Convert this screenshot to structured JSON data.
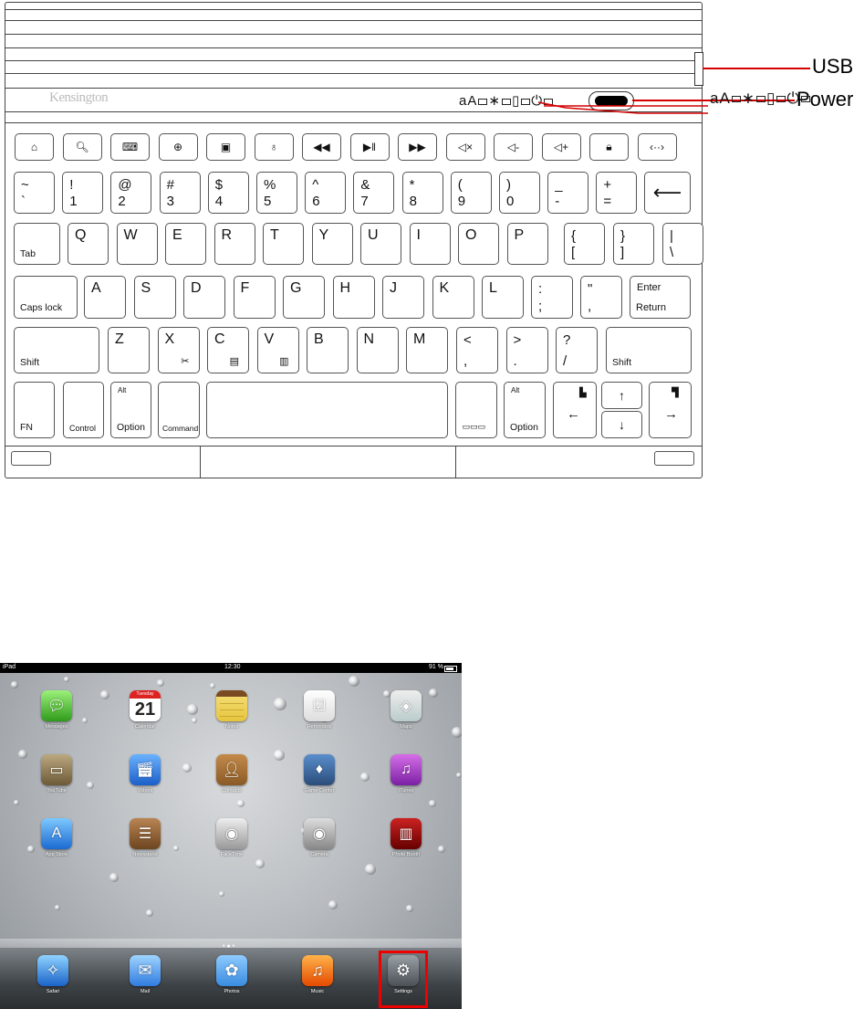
{
  "callouts": {
    "usb": "USB",
    "power": "Power"
  },
  "keyboard": {
    "brand": "Kensington",
    "indicator": "aA",
    "function_row_icons": [
      "home-icon",
      "search-icon",
      "virtual-keyboard-icon",
      "globe-icon",
      "slideshow-icon",
      "microphone-icon",
      "previous-track-icon",
      "play-pause-icon",
      "next-track-icon",
      "mute-icon",
      "volume-down-icon",
      "volume-up-icon",
      "lock-icon",
      "select-text-icon"
    ],
    "row1": [
      {
        "t": "~",
        "b": "`"
      },
      {
        "t": "!",
        "b": "1"
      },
      {
        "t": "@",
        "b": "2"
      },
      {
        "t": "#",
        "b": "3"
      },
      {
        "t": "$",
        "b": "4"
      },
      {
        "t": "%",
        "b": "5"
      },
      {
        "t": "^",
        "b": "6"
      },
      {
        "t": "&",
        "b": "7"
      },
      {
        "t": "*",
        "b": "8"
      },
      {
        "t": "(",
        "b": "9"
      },
      {
        "t": ")",
        "b": "0"
      },
      {
        "t": "_",
        "b": "-"
      },
      {
        "t": "+",
        "b": "="
      }
    ],
    "row2": {
      "tab": "Tab",
      "letters": [
        "Q",
        "W",
        "E",
        "R",
        "T",
        "Y",
        "U",
        "I",
        "O",
        "P"
      ],
      "brackets": [
        {
          "t": "{",
          "b": "["
        },
        {
          "t": "}",
          "b": "]"
        },
        {
          "t": "|",
          "b": "\\"
        }
      ]
    },
    "row3": {
      "caps": "Caps lock",
      "letters": [
        "A",
        "S",
        "D",
        "F",
        "G",
        "H",
        "J",
        "K",
        "L"
      ],
      "punct": [
        {
          "t": ":",
          "b": ";"
        },
        {
          "t": "\"",
          "b": ","
        }
      ],
      "enter_top": "Enter",
      "enter_bottom": "Return"
    },
    "row4": {
      "shift_left": "Shift",
      "letters": [
        "Z",
        "X",
        "C",
        "V",
        "B",
        "N",
        "M"
      ],
      "punct": [
        {
          "t": "<",
          "b": ","
        },
        {
          "t": ">",
          "b": "."
        },
        {
          "t": "?",
          "b": "/"
        }
      ],
      "shift_right": "Shift"
    },
    "row5": {
      "fn": "FN",
      "control": "Control",
      "alt": "Alt",
      "option": "Option",
      "command": "Command",
      "alt_right": "Alt",
      "option_right": "Option"
    }
  },
  "ipad": {
    "status": {
      "device": "iPad",
      "time": "12:30",
      "battery": "91 %"
    },
    "calendar": {
      "day": "Tuesday",
      "date": "21"
    },
    "apps": [
      "Messages",
      "Calendar",
      "Notes",
      "Reminders",
      "Maps",
      "YouTube",
      "Videos",
      "Contacts",
      "Game Center",
      "iTunes",
      "App Store",
      "Newsstand",
      "FaceTime",
      "Camera",
      "Photo Booth"
    ],
    "dock": [
      "Safari",
      "Mail",
      "Photos",
      "Music",
      "Settings"
    ]
  }
}
